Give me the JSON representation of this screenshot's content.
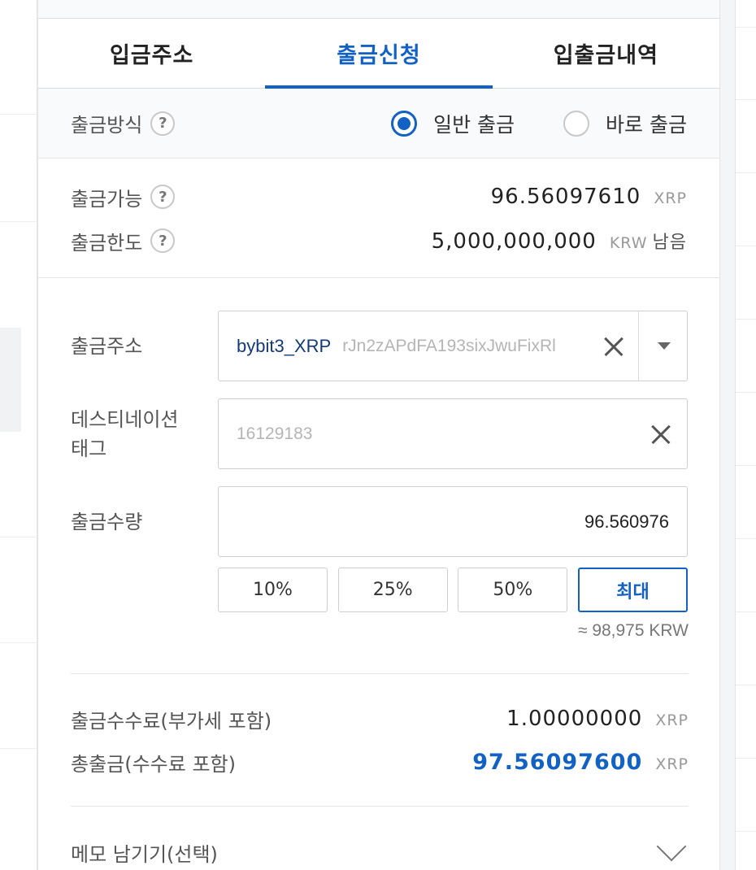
{
  "tabs": [
    {
      "label": "입금주소",
      "active": false
    },
    {
      "label": "출금신청",
      "active": true
    },
    {
      "label": "입출금내역",
      "active": false
    }
  ],
  "method": {
    "label": "출금방식",
    "options": [
      {
        "label": "일반 출금",
        "selected": true
      },
      {
        "label": "바로 출금",
        "selected": false
      }
    ]
  },
  "available": {
    "label": "출금가능",
    "value": "96.56097610",
    "unit": "XRP"
  },
  "limit": {
    "label": "출금한도",
    "value": "5,000,000,000",
    "unit": "KRW",
    "suffix": "남음"
  },
  "address": {
    "label": "출금주소",
    "name": "bybit3_XRP",
    "address": "rJn2zAPdFA193sixJwuFixRl"
  },
  "tag": {
    "label_line1": "데스티네이션",
    "label_line2": "태그",
    "value": "16129183"
  },
  "quantity": {
    "label": "출금수량",
    "value": "96.560976"
  },
  "pct_buttons": [
    "10%",
    "25%",
    "50%",
    "최대"
  ],
  "approx": "≈ 98,975 KRW",
  "fee": {
    "label": "출금수수료(부가세 포함)",
    "value": "1.00000000",
    "unit": "XRP"
  },
  "total": {
    "label": "총출금(수수료 포함)",
    "value": "97.56097600",
    "unit": "XRP"
  },
  "memo": {
    "label": "메모 남기기(선택)"
  },
  "colors": {
    "accent": "#1261c4"
  }
}
